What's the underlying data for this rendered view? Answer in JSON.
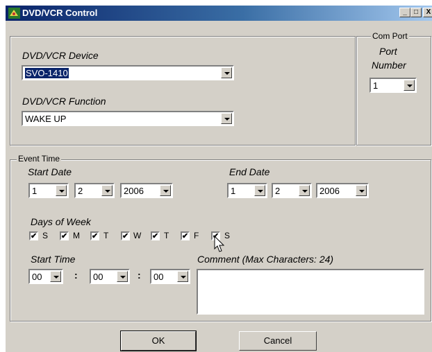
{
  "window": {
    "title": "DVD/VCR Control",
    "min": "_",
    "max": "□",
    "close": "X"
  },
  "device": {
    "label": "DVD/VCR Device",
    "value": "SVO-1410"
  },
  "function": {
    "label": "DVD/VCR Function",
    "value": "WAKE UP"
  },
  "com_port": {
    "group_label": "Com Port",
    "label_line1": "Port",
    "label_line2": "Number",
    "value": "1"
  },
  "event_time": {
    "group_label": "Event Time",
    "start_date": {
      "label": "Start Date",
      "month": "1",
      "day": "2",
      "year": "2006"
    },
    "end_date": {
      "label": "End Date",
      "month": "1",
      "day": "2",
      "year": "2006"
    },
    "days_label": "Days of Week",
    "days": [
      {
        "letter": "S",
        "checked": true
      },
      {
        "letter": "M",
        "checked": true
      },
      {
        "letter": "T",
        "checked": true
      },
      {
        "letter": "W",
        "checked": true
      },
      {
        "letter": "T",
        "checked": true
      },
      {
        "letter": "F",
        "checked": true
      },
      {
        "letter": "S",
        "checked": true
      }
    ],
    "start_time": {
      "label": "Start Time",
      "hour": "00",
      "minute": "00",
      "second": "00",
      "sep": ":"
    },
    "comment": {
      "label": "Comment (Max Characters: 24)",
      "value": ""
    }
  },
  "buttons": {
    "ok": "OK",
    "cancel": "Cancel"
  },
  "check_mark": "✔"
}
